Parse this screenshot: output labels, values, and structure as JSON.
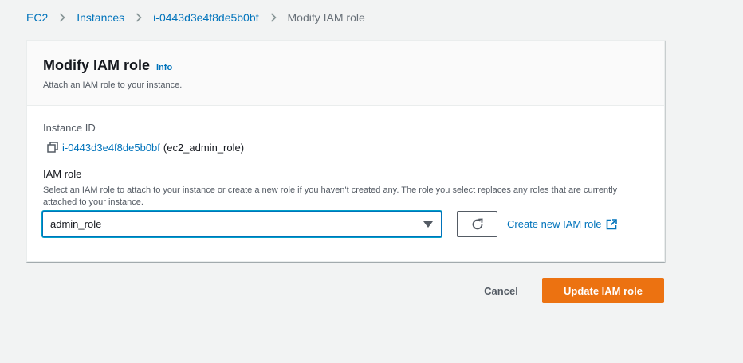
{
  "breadcrumb": {
    "items": [
      "EC2",
      "Instances",
      "i-0443d3e4f8de5b0bf"
    ],
    "current": "Modify IAM role"
  },
  "panel": {
    "title": "Modify IAM role",
    "info_label": "Info",
    "description": "Attach an IAM role to your instance."
  },
  "instance": {
    "label": "Instance ID",
    "id": "i-0443d3e4f8de5b0bf",
    "name": "(ec2_admin_role)"
  },
  "iam_role": {
    "label": "IAM role",
    "description": "Select an IAM role to attach to your instance or create a new role if you haven't created any. The role you select replaces any roles that are currently attached to your instance.",
    "selected_value": "admin_role",
    "create_link_label": "Create new IAM role"
  },
  "actions": {
    "cancel_label": "Cancel",
    "update_label": "Update IAM role"
  },
  "colors": {
    "link": "#0073bb",
    "primary_button": "#ec7211",
    "page_background": "#f2f3f3"
  },
  "icons": {
    "breadcrumb_separator": "chevron-right-icon",
    "copy": "copy-icon",
    "select_caret": "caret-down-icon",
    "refresh": "refresh-icon",
    "external_link": "external-link-icon"
  }
}
